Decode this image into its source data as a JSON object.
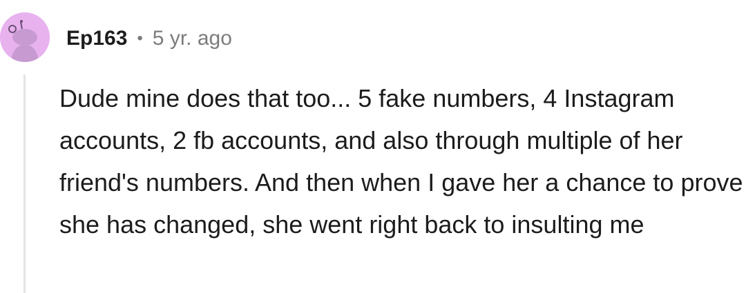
{
  "comment": {
    "username": "Ep163",
    "separator": "•",
    "timestamp": "5 yr. ago",
    "avatar_icon": "snoo-avatar-icon",
    "avatar_color": "#e8b2ef",
    "body": "Dude mine does that too... 5 fake numbers, 4 Instagram accounts, 2 fb accounts, and also through multiple of her friend's numbers. And then when I gave her a chance to prove she has changed, she went right back to insulting me"
  }
}
